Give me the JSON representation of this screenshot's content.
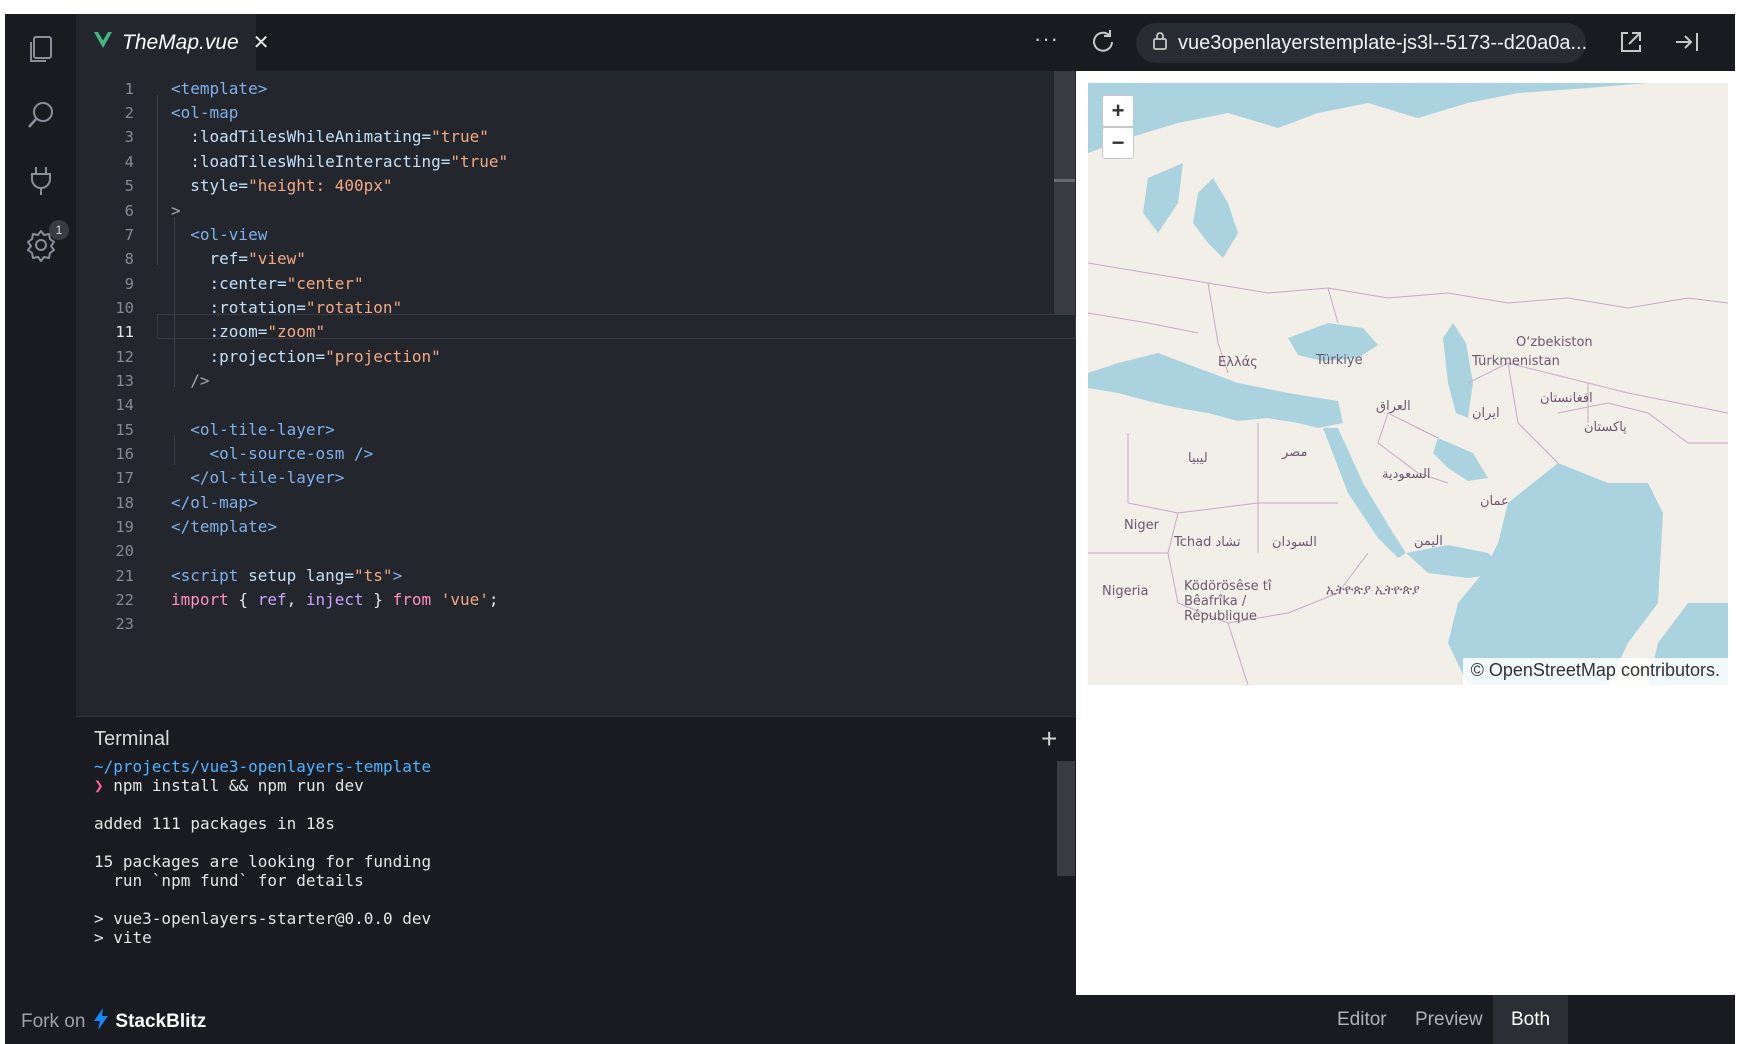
{
  "activity_bar": {
    "items": [
      {
        "icon": "files-icon"
      },
      {
        "icon": "search-icon"
      },
      {
        "icon": "plug-icon",
        "badge": "1"
      },
      {
        "icon": "gear-icon"
      }
    ]
  },
  "editor": {
    "tab": {
      "label": "TheMap.vue",
      "icon": "vue-icon"
    },
    "more_label": "···",
    "current_line": 11,
    "line_numbers": [
      "1",
      "2",
      "3",
      "4",
      "5",
      "6",
      "7",
      "8",
      "9",
      "10",
      "11",
      "12",
      "13",
      "14",
      "15",
      "16",
      "17",
      "18",
      "19",
      "20",
      "21",
      "22",
      "23"
    ],
    "code": {
      "l1_open": "<template>",
      "l2_open": "<ol-map",
      "l3_attr": ":loadTilesWhileAnimating=",
      "l3_val": "\"true\"",
      "l4_attr": ":loadTilesWhileInteracting=",
      "l4_val": "\"true\"",
      "l5_attr": "style=",
      "l5_val": "\"height: 400px\"",
      "l6_close": ">",
      "l7_open": "<ol-view",
      "l8_attr": "ref=",
      "l8_val": "\"view\"",
      "l9_attr": ":center=",
      "l9_val": "\"center\"",
      "l10_attr": ":rotation=",
      "l10_val": "\"rotation\"",
      "l11_attr": ":zoom=",
      "l11_val": "\"zoom\"",
      "l12_attr": ":projection=",
      "l12_val": "\"projection\"",
      "l13_close": "/>",
      "l15_open": "<ol-tile-layer>",
      "l16_open": "<ol-source-osm />",
      "l17_close": "</ol-tile-layer>",
      "l18_close": "</ol-map>",
      "l19_close": "</template>",
      "l21_tag": "<script",
      "l21_kw": " setup",
      "l21_attr": " lang=",
      "l21_val": "\"ts\"",
      "l21_end": ">",
      "l22_kw1": "import",
      "l22_mid": " { ",
      "l22_v1": "ref",
      "l22_comma": ", ",
      "l22_v2": "inject",
      "l22_end1": " } ",
      "l22_kw2": "from",
      "l22_sp": " ",
      "l22_val": "'vue'",
      "l22_semi": ";"
    }
  },
  "terminal": {
    "title": "Terminal",
    "lines": [
      "~/projects/vue3-openlayers-template",
      "npm install && npm run dev",
      "",
      "added 111 packages in 18s",
      "",
      "15 packages are looking for funding",
      "  run `npm fund` for details",
      "",
      "> vue3-openlayers-starter@0.0.0 dev",
      "> vite"
    ],
    "prompt_symbol": "❯",
    "path_color": "#4fb3ff",
    "prompt_color": "#ff5fa2"
  },
  "preview": {
    "url": "vue3openlayerstemplate-js3l--5173--d20a0a...",
    "map": {
      "zoom_in": "+",
      "zoom_out": "−",
      "attribution": "© OpenStreetMap contributors.",
      "labels": [
        "Ελλάς",
        "Türkiye",
        "Oʻzbekiston",
        "Türkmenistan",
        "العراق",
        "ایران",
        "افغانستان",
        "پاکستان",
        "ليبيا",
        "مصر",
        "السعودية",
        "عمان",
        "Niger",
        "Tchad تشاد",
        "السودان",
        "اليمن",
        "Nigeria",
        "Ködörösêse tî Bêafrîka / République",
        "ኢትዮጵያ ኢትዮጵያ"
      ]
    }
  },
  "bottom_bar": {
    "fork_label": "Fork on",
    "brand": "StackBlitz",
    "views": [
      "Editor",
      "Preview",
      "Both"
    ],
    "active_view": "Both"
  },
  "colors": {
    "background": "#1f2026",
    "editor_bg": "#24262e",
    "tag": "#7fb0e8",
    "string": "#f2a981",
    "keyword": "#ff8fbf",
    "map_water": "#aad3df",
    "map_land": "#f2efe9",
    "brand_bolt": "#1389fd"
  }
}
